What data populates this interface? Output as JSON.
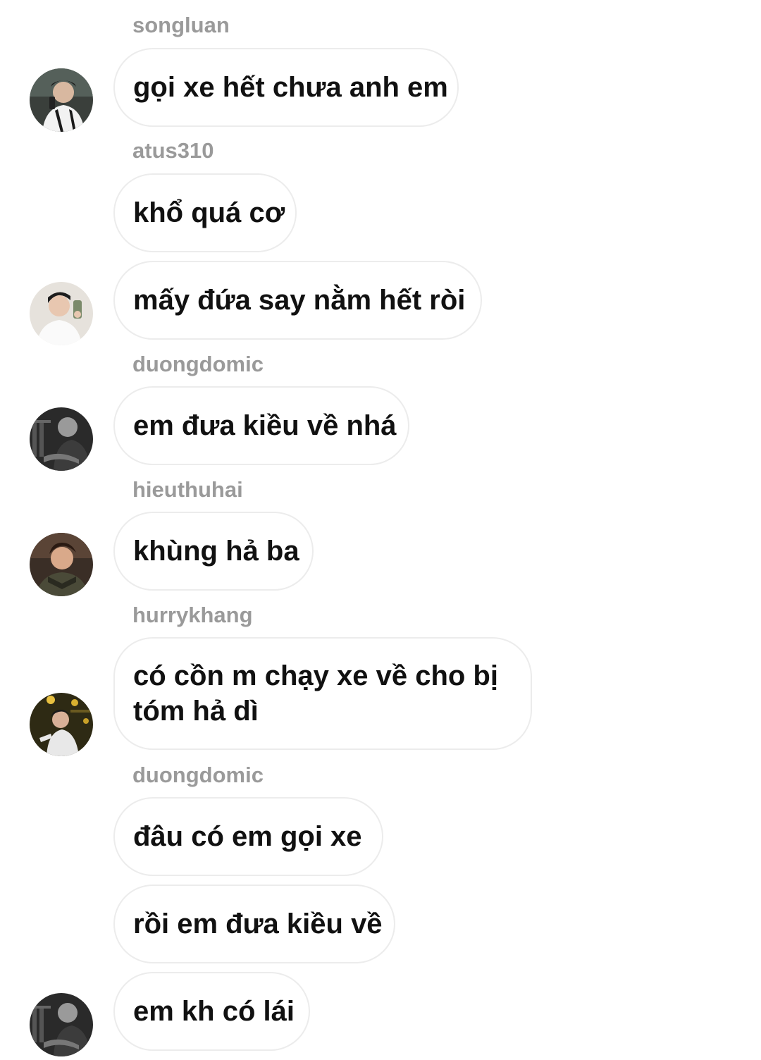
{
  "messages": [
    {
      "username": "songluan",
      "text": "gọi xe hết chưa anh em",
      "avatar": "avatar-songluan"
    },
    {
      "username": "atus310",
      "text": "khổ quá cơ",
      "avatar": null
    },
    {
      "username": "",
      "text": "mấy đứa say nằm hết ròi",
      "avatar": "avatar-atus310"
    },
    {
      "username": "duongdomic",
      "text": "em đưa kiều về nhá",
      "avatar": "avatar-duongdomic"
    },
    {
      "username": "hieuthuhai",
      "text": "khùng hả ba",
      "avatar": "avatar-hieuthuhai"
    },
    {
      "username": "hurrykhang",
      "text": "có cồn m chạy xe về cho bị tóm hả dì",
      "avatar": "avatar-hurrykhang"
    },
    {
      "username": "duongdomic",
      "text": "đâu có em gọi xe",
      "avatar": null
    },
    {
      "username": "",
      "text": "rồi em đưa kiều về",
      "avatar": null
    },
    {
      "username": "",
      "text": "em kh có lái",
      "avatar": "avatar-duongdomic"
    }
  ],
  "colors": {
    "background": "#ffffff",
    "bubble_border": "#ececec",
    "username": "#9a9a9a",
    "message_text": "#111111"
  }
}
